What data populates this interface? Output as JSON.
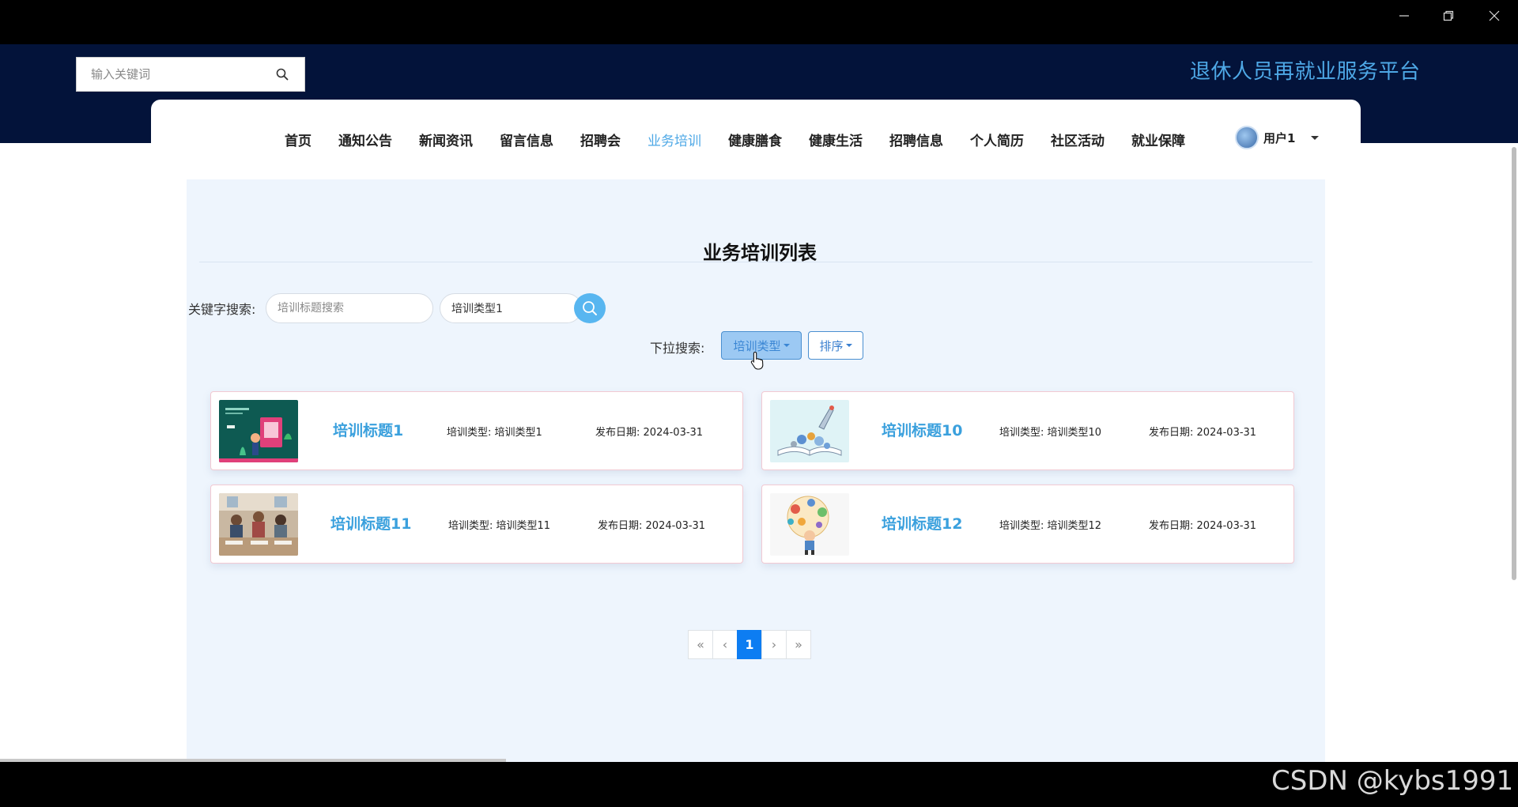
{
  "window": {
    "minimize_icon": "minimize-icon",
    "maximize_icon": "restore-icon",
    "close_icon": "close-icon"
  },
  "header": {
    "search_placeholder": "输入关键词",
    "site_title": "退休人员再就业服务平台"
  },
  "nav": {
    "items": [
      "首页",
      "通知公告",
      "新闻资讯",
      "留言信息",
      "招聘会",
      "业务培训",
      "健康膳食",
      "健康生活",
      "招聘信息",
      "个人简历",
      "社区活动",
      "就业保障"
    ],
    "active": "业务培训",
    "user": "用户1"
  },
  "main": {
    "title": "业务培训列表",
    "keyword_label": "关键字搜索:",
    "title_search_placeholder": "培训标题搜索",
    "type_search_value": "培训类型1",
    "dropdown_label": "下拉搜索:",
    "type_dropdown": "培训类型",
    "sort_dropdown": "排序"
  },
  "cards": [
    {
      "title": "培训标题1",
      "type_label": "培训类型:",
      "type": "培训类型1",
      "date_label": "发布日期:",
      "date": "2024-03-31"
    },
    {
      "title": "培训标题10",
      "type_label": "培训类型:",
      "type": "培训类型10",
      "date_label": "发布日期:",
      "date": "2024-03-31"
    },
    {
      "title": "培训标题11",
      "type_label": "培训类型:",
      "type": "培训类型11",
      "date_label": "发布日期:",
      "date": "2024-03-31"
    },
    {
      "title": "培训标题12",
      "type_label": "培训类型:",
      "type": "培训类型12",
      "date_label": "发布日期:",
      "date": "2024-03-31"
    }
  ],
  "pagination": {
    "first": "«",
    "prev": "‹",
    "current": "1",
    "next": "›",
    "last": "»"
  },
  "watermark": "CSDN @kybs1991",
  "colors": {
    "header_bg": "#03133a",
    "accent": "#4ea8e6",
    "panel_bg": "#eef5fd",
    "page_active": "#0d7df2"
  }
}
